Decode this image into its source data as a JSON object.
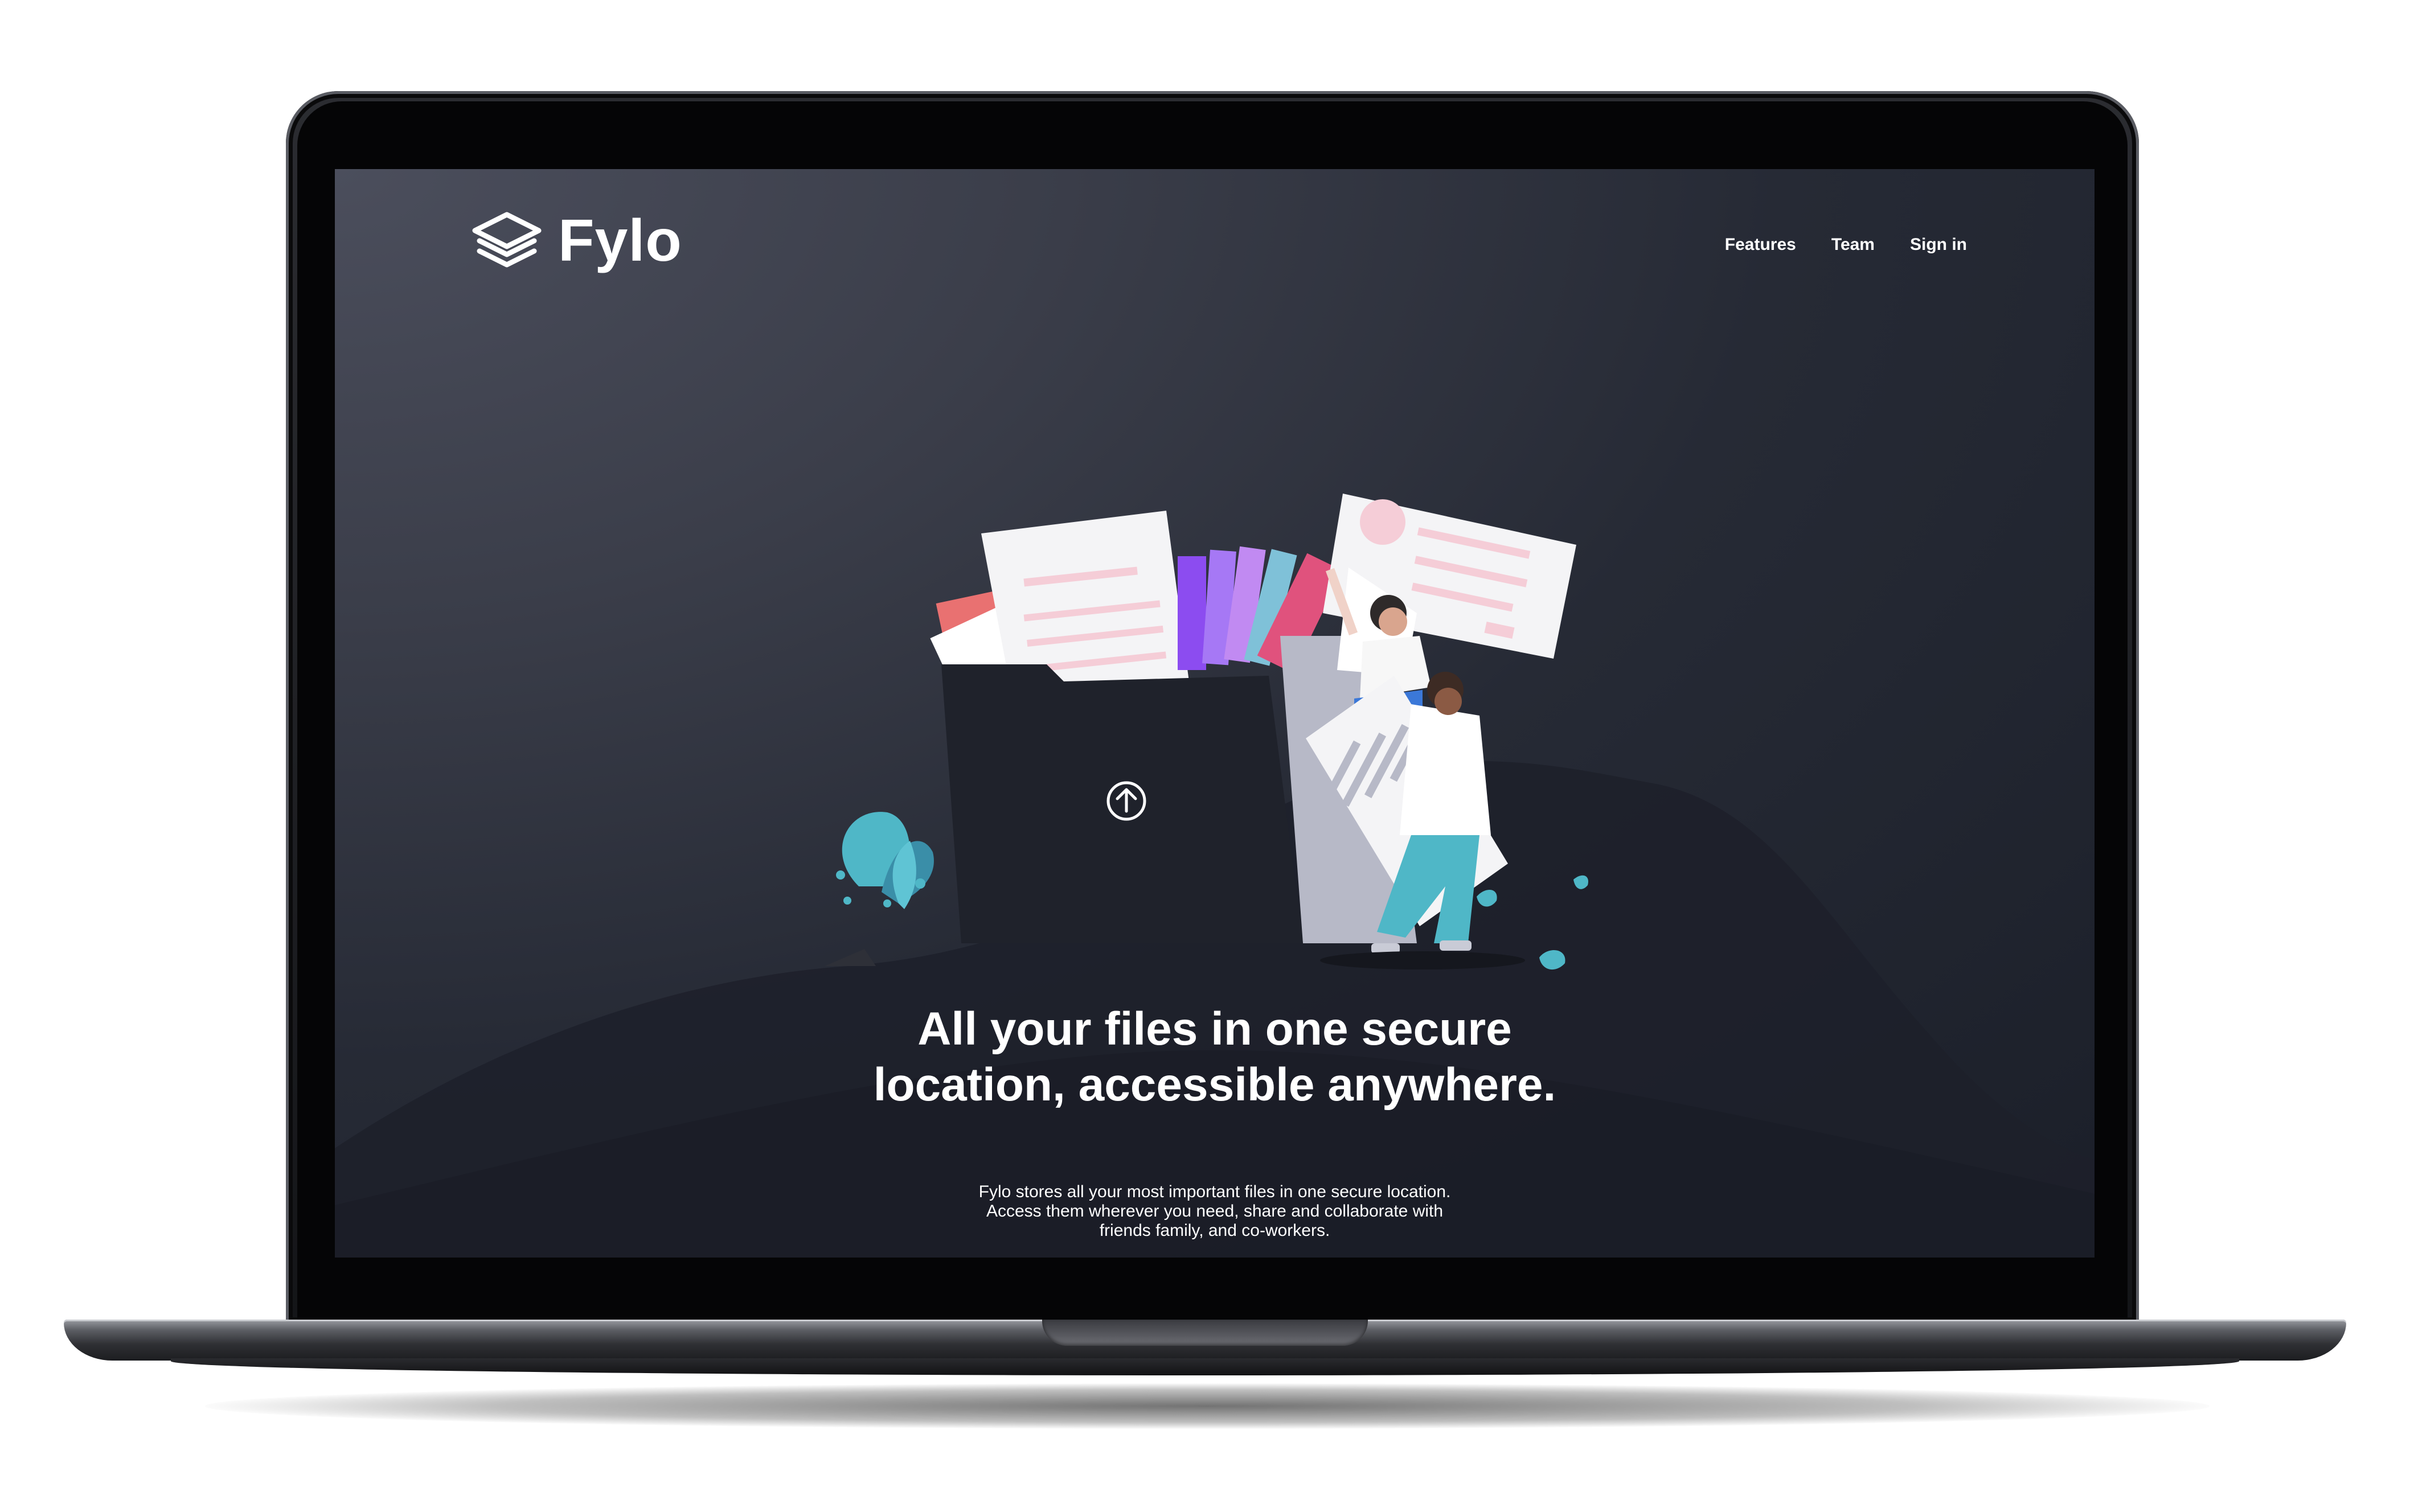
{
  "brand": {
    "name": "Fylo",
    "logo_icon": "stacked-layers-icon"
  },
  "nav": {
    "items": [
      "Features",
      "Team",
      "Sign in"
    ]
  },
  "hero": {
    "title": "All your files in one secure location, accessible anywhere.",
    "description": "Fylo stores all your most important files in one secure location. Access them wherever you need, share and collaborate with friends family, and co-workers."
  },
  "illustration": {
    "upload_icon": "upload-arrow-icon"
  },
  "colors": {
    "page_bg": "#1b1f29",
    "page_bg_light": "#4b4e5c",
    "text": "#ffffff",
    "accent_teal": "#4fb7c7",
    "accent_pink": "#e0527d",
    "accent_purple": "#8c4cf0"
  }
}
